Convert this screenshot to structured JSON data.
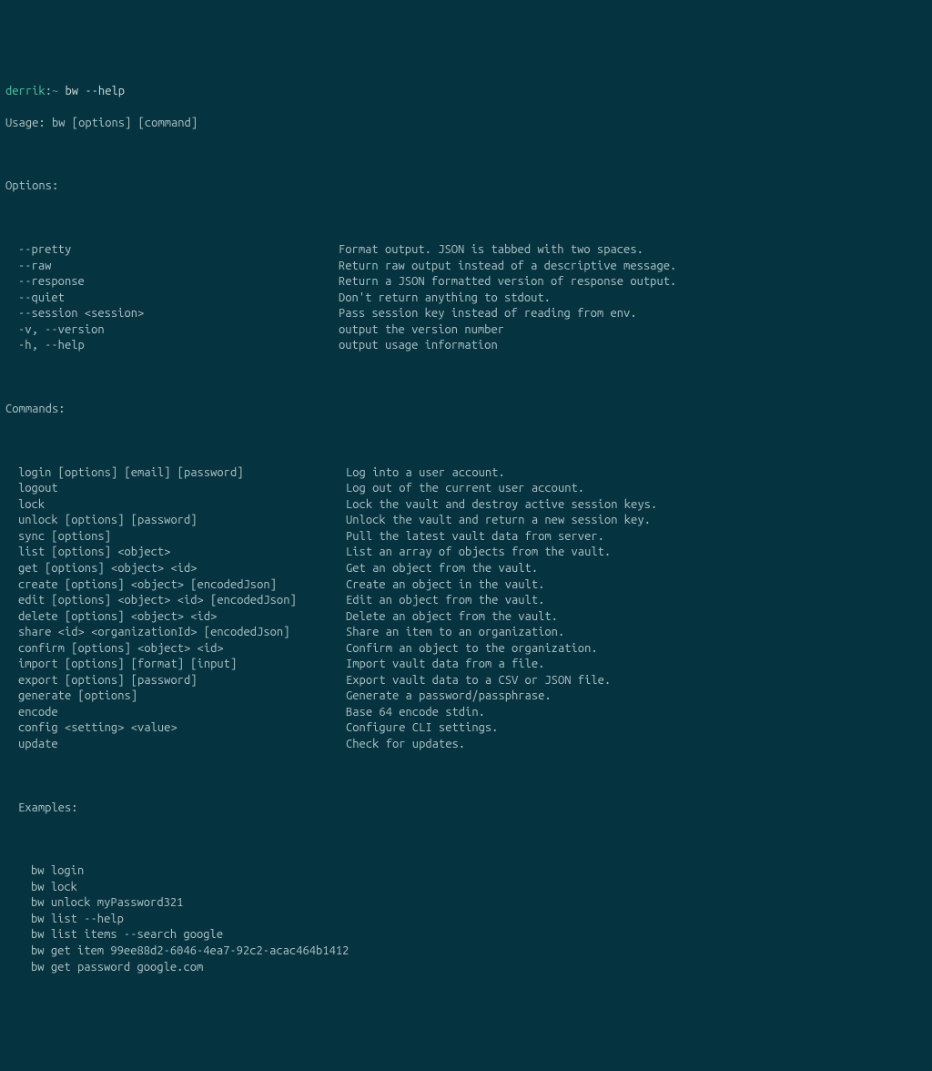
{
  "prompt": {
    "user": "derrik",
    "sep": ":",
    "path": "~",
    "command": "bw --help"
  },
  "usage": "Usage: bw [options] [command]",
  "options_header": "Options:",
  "options": [
    {
      "flag": "--pretty",
      "desc": "Format output. JSON is tabbed with two spaces."
    },
    {
      "flag": "--raw",
      "desc": "Return raw output instead of a descriptive message."
    },
    {
      "flag": "--response",
      "desc": "Return a JSON formatted version of response output."
    },
    {
      "flag": "--quiet",
      "desc": "Don't return anything to stdout."
    },
    {
      "flag": "--session <session>",
      "desc": "Pass session key instead of reading from env."
    },
    {
      "flag": "-v, --version",
      "desc": "output the version number"
    },
    {
      "flag": "-h, --help",
      "desc": "output usage information"
    }
  ],
  "commands_header": "Commands:",
  "commands": [
    {
      "cmd": "login [options] [email] [password]",
      "desc": "Log into a user account."
    },
    {
      "cmd": "logout",
      "desc": "Log out of the current user account."
    },
    {
      "cmd": "lock",
      "desc": "Lock the vault and destroy active session keys."
    },
    {
      "cmd": "unlock [options] [password]",
      "desc": "Unlock the vault and return a new session key."
    },
    {
      "cmd": "sync [options]",
      "desc": "Pull the latest vault data from server."
    },
    {
      "cmd": "list [options] <object>",
      "desc": "List an array of objects from the vault."
    },
    {
      "cmd": "get [options] <object> <id>",
      "desc": "Get an object from the vault."
    },
    {
      "cmd": "create [options] <object> [encodedJson]",
      "desc": "Create an object in the vault."
    },
    {
      "cmd": "edit [options] <object> <id> [encodedJson]",
      "desc": "Edit an object from the vault."
    },
    {
      "cmd": "delete [options] <object> <id>",
      "desc": "Delete an object from the vault."
    },
    {
      "cmd": "share <id> <organizationId> [encodedJson]",
      "desc": "Share an item to an organization."
    },
    {
      "cmd": "confirm [options] <object> <id>",
      "desc": "Confirm an object to the organization."
    },
    {
      "cmd": "import [options] [format] [input]",
      "desc": "Import vault data from a file."
    },
    {
      "cmd": "export [options] [password]",
      "desc": "Export vault data to a CSV or JSON file."
    },
    {
      "cmd": "generate [options]",
      "desc": "Generate a password/passphrase."
    },
    {
      "cmd": "encode",
      "desc": "Base 64 encode stdin."
    },
    {
      "cmd": "config <setting> <value>",
      "desc": "Configure CLI settings."
    },
    {
      "cmd": "update",
      "desc": "Check for updates."
    }
  ],
  "examples_header": "Examples:",
  "examples": [
    "bw login",
    "bw lock",
    "bw unlock myPassword321",
    "bw list --help",
    "bw list items --search google",
    "bw get item 99ee88d2-6046-4ea7-92c2-acac464b1412",
    "bw get password google.com"
  ]
}
